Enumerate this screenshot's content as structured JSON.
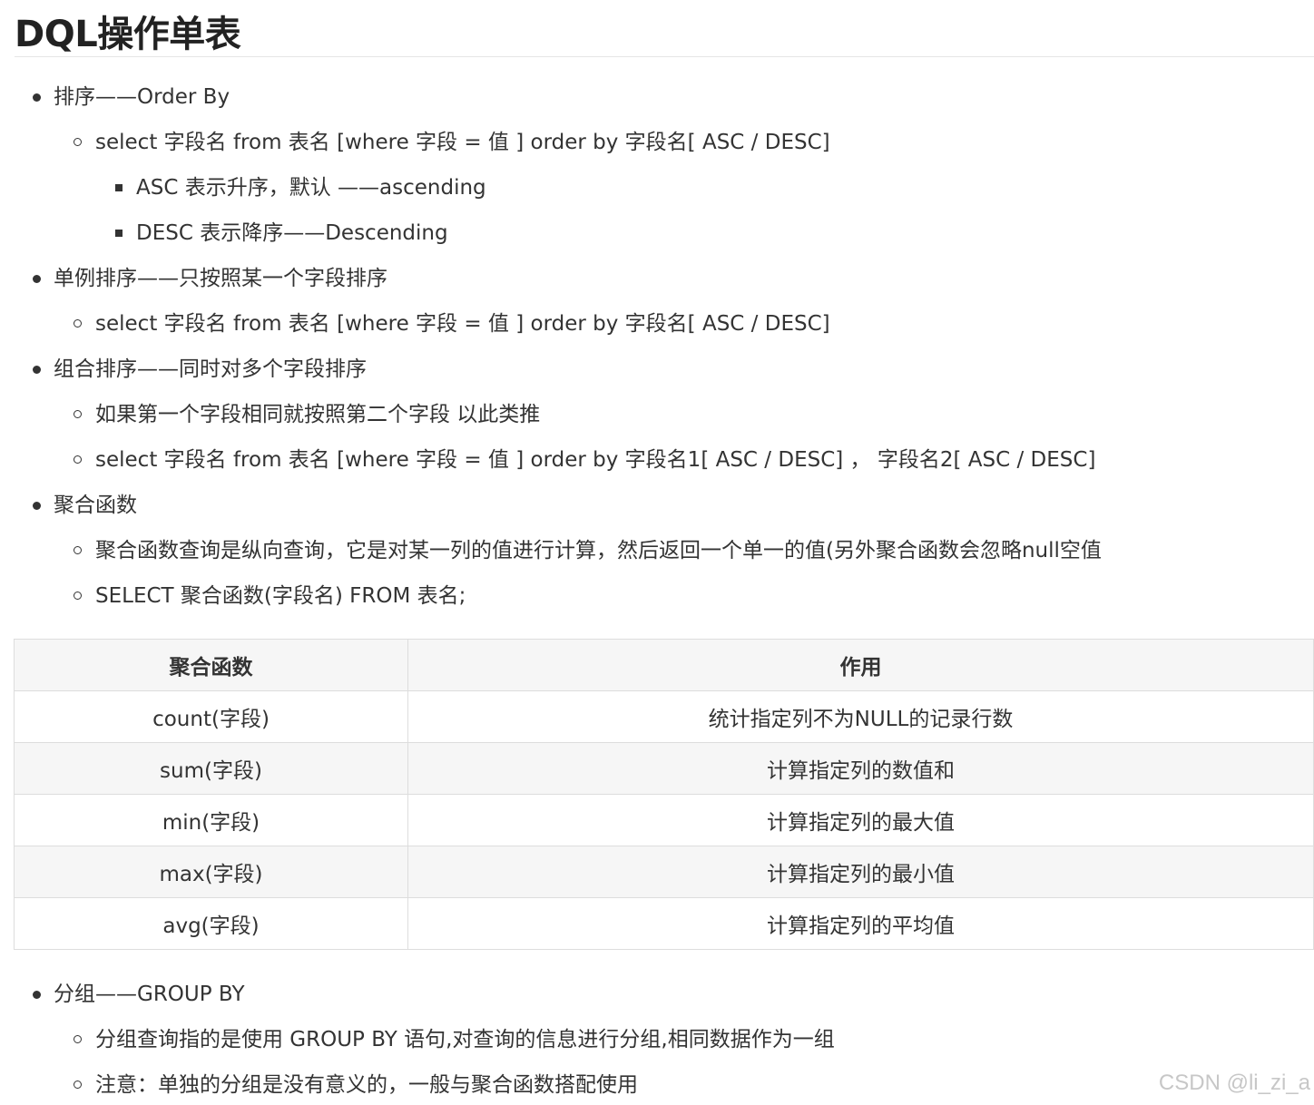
{
  "page": {
    "title": "DQL操作单表"
  },
  "list_top": [
    {
      "level": 1,
      "text": "排序——Order By"
    },
    {
      "level": 2,
      "text": "select 字段名 from 表名 [where 字段 = 值 ] order by 字段名[ ASC / DESC]"
    },
    {
      "level": 3,
      "text": "ASC 表示升序，默认 ——ascending"
    },
    {
      "level": 3,
      "text": "DESC 表示降序——Descending"
    },
    {
      "level": 1,
      "text": "单例排序——只按照某一个字段排序"
    },
    {
      "level": 2,
      "text": "select 字段名 from 表名 [where 字段 = 值 ] order by 字段名[ ASC / DESC]"
    },
    {
      "level": 1,
      "text": "组合排序——同时对多个字段排序"
    },
    {
      "level": 2,
      "text": "如果第一个字段相同就按照第二个字段 以此类推"
    },
    {
      "level": 2,
      "text": "select 字段名 from 表名 [where 字段 = 值 ] order by 字段名1[ ASC / DESC] ， 字段名2[ ASC / DESC]"
    },
    {
      "level": 1,
      "text": "聚合函数"
    },
    {
      "level": 2,
      "text": "聚合函数查询是纵向查询，它是对某一列的值进行计算，然后返回一个单一的值(另外聚合函数会忽略null空值"
    },
    {
      "level": 2,
      "text": "SELECT 聚合函数(字段名) FROM 表名;"
    }
  ],
  "table": {
    "headers": [
      "聚合函数",
      "作用"
    ],
    "rows": [
      [
        "count(字段)",
        "统计指定列不为NULL的记录行数"
      ],
      [
        "sum(字段)",
        "计算指定列的数值和"
      ],
      [
        "min(字段)",
        "计算指定列的最大值"
      ],
      [
        "max(字段)",
        "计算指定列的最小值"
      ],
      [
        "avg(字段)",
        "计算指定列的平均值"
      ]
    ]
  },
  "list_bottom": [
    {
      "level": 1,
      "text": "分组——GROUP BY"
    },
    {
      "level": 2,
      "text": "分组查询指的是使用 GROUP BY 语句,对查询的信息进行分组,相同数据作为一组"
    },
    {
      "level": 2,
      "text": "注意：单独的分组是没有意义的，一般与聚合函数搭配使用"
    }
  ],
  "watermark": "CSDN @li_zi_a"
}
